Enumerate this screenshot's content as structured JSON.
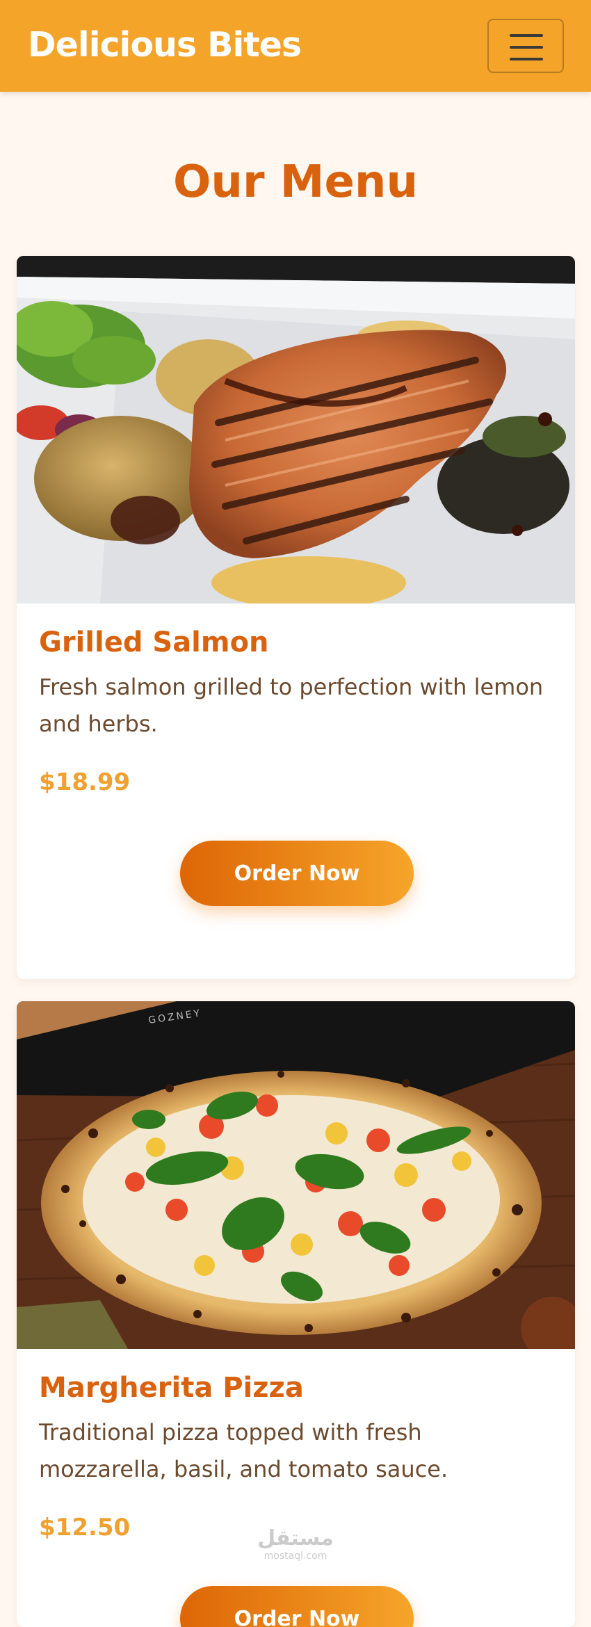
{
  "navbar": {
    "brand": "Delicious Bites",
    "toggle_icon": "hamburger-menu-icon",
    "background_color": "#f5a42a"
  },
  "page": {
    "heading": "Our Menu",
    "accent_color": "#d9620e"
  },
  "menu_items": [
    {
      "name": "Grilled Salmon",
      "description": "Fresh salmon grilled to perfection with lemon and herbs.",
      "price": "$18.99",
      "button_label": "Order Now",
      "image": "grilled-salmon-photo"
    },
    {
      "name": "Margherita Pizza",
      "description": "Traditional pizza topped with fresh mozzarella, basil, and tomato sauce.",
      "price": "$12.50",
      "button_label": "Order Now",
      "image": "margherita-pizza-photo"
    }
  ],
  "photo_text": {
    "oven_brand": "GOZNEY"
  },
  "watermark": {
    "arabic": "مستقل",
    "latin": "mostaql.com"
  }
}
